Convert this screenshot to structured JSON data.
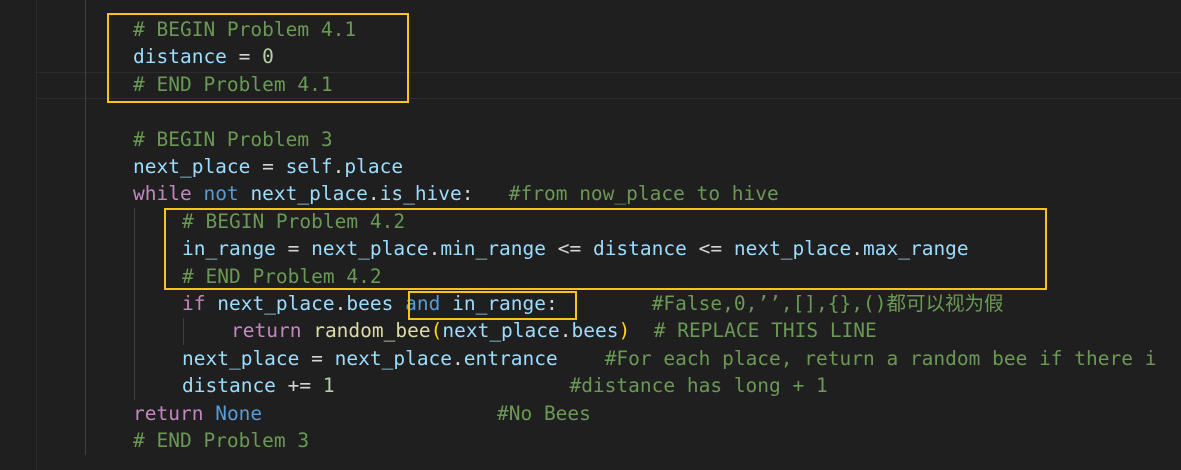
{
  "editor": {
    "lines": [
      {
        "indent": 2,
        "tokens": [
          {
            "t": "# BEGIN Problem 4.1",
            "c": "comment"
          }
        ]
      },
      {
        "indent": 2,
        "tokens": [
          {
            "t": "distance",
            "c": "ident"
          },
          {
            "t": " = ",
            "c": "op"
          },
          {
            "t": "0",
            "c": "num"
          }
        ]
      },
      {
        "indent": 2,
        "tokens": [
          {
            "t": "# END Problem 4.1",
            "c": "comment"
          }
        ]
      },
      {
        "indent": 0,
        "tokens": []
      },
      {
        "indent": 2,
        "tokens": [
          {
            "t": "# BEGIN Problem 3",
            "c": "comment"
          }
        ]
      },
      {
        "indent": 2,
        "tokens": [
          {
            "t": "next_place",
            "c": "ident"
          },
          {
            "t": " = ",
            "c": "op"
          },
          {
            "t": "self",
            "c": "ident"
          },
          {
            "t": ".",
            "c": "op"
          },
          {
            "t": "place",
            "c": "ident"
          }
        ]
      },
      {
        "indent": 2,
        "tokens": [
          {
            "t": "while",
            "c": "kw"
          },
          {
            "t": " ",
            "c": "op"
          },
          {
            "t": "not",
            "c": "kw2"
          },
          {
            "t": " ",
            "c": "op"
          },
          {
            "t": "next_place",
            "c": "ident"
          },
          {
            "t": ".",
            "c": "op"
          },
          {
            "t": "is_hive",
            "c": "ident"
          },
          {
            "t": ":   ",
            "c": "op"
          },
          {
            "t": "#from now_place to hive",
            "c": "comment"
          }
        ]
      },
      {
        "indent": 3,
        "tokens": [
          {
            "t": "# BEGIN Problem 4.2",
            "c": "comment"
          }
        ]
      },
      {
        "indent": 3,
        "tokens": [
          {
            "t": "in_range",
            "c": "ident"
          },
          {
            "t": " = ",
            "c": "op"
          },
          {
            "t": "next_place",
            "c": "ident"
          },
          {
            "t": ".",
            "c": "op"
          },
          {
            "t": "min_range",
            "c": "ident"
          },
          {
            "t": " <= ",
            "c": "op"
          },
          {
            "t": "distance",
            "c": "ident"
          },
          {
            "t": " <= ",
            "c": "op"
          },
          {
            "t": "next_place",
            "c": "ident"
          },
          {
            "t": ".",
            "c": "op"
          },
          {
            "t": "max_range",
            "c": "ident"
          }
        ]
      },
      {
        "indent": 3,
        "tokens": [
          {
            "t": "# END Problem 4.2",
            "c": "comment"
          }
        ]
      },
      {
        "indent": 3,
        "tokens": [
          {
            "t": "if",
            "c": "kw"
          },
          {
            "t": " ",
            "c": "op"
          },
          {
            "t": "next_place",
            "c": "ident"
          },
          {
            "t": ".",
            "c": "op"
          },
          {
            "t": "bees",
            "c": "ident"
          },
          {
            "t": " ",
            "c": "op"
          },
          {
            "t": "and",
            "c": "kw2"
          },
          {
            "t": " ",
            "c": "op"
          },
          {
            "t": "in_range",
            "c": "ident"
          },
          {
            "t": ":        ",
            "c": "op"
          },
          {
            "t": "#False,0,’’,[],{},()都可以视为假",
            "c": "comment"
          }
        ]
      },
      {
        "indent": 4,
        "tokens": [
          {
            "t": "return",
            "c": "kw"
          },
          {
            "t": " ",
            "c": "op"
          },
          {
            "t": "random_bee",
            "c": "func"
          },
          {
            "t": "(",
            "c": "paren"
          },
          {
            "t": "next_place",
            "c": "ident"
          },
          {
            "t": ".",
            "c": "op"
          },
          {
            "t": "bees",
            "c": "ident"
          },
          {
            "t": ")",
            "c": "paren"
          },
          {
            "t": "  ",
            "c": "op"
          },
          {
            "t": "# REPLACE THIS LINE",
            "c": "comment"
          }
        ]
      },
      {
        "indent": 3,
        "tokens": [
          {
            "t": "next_place",
            "c": "ident"
          },
          {
            "t": " = ",
            "c": "op"
          },
          {
            "t": "next_place",
            "c": "ident"
          },
          {
            "t": ".",
            "c": "op"
          },
          {
            "t": "entrance",
            "c": "ident"
          },
          {
            "t": "    ",
            "c": "op"
          },
          {
            "t": "#For each place, return a random bee if there i",
            "c": "comment"
          }
        ]
      },
      {
        "indent": 3,
        "tokens": [
          {
            "t": "distance",
            "c": "ident"
          },
          {
            "t": " += ",
            "c": "op"
          },
          {
            "t": "1",
            "c": "num"
          },
          {
            "t": "                    ",
            "c": "op"
          },
          {
            "t": "#distance has long + 1",
            "c": "comment"
          }
        ]
      },
      {
        "indent": 2,
        "tokens": [
          {
            "t": "return",
            "c": "kw"
          },
          {
            "t": " ",
            "c": "op"
          },
          {
            "t": "None",
            "c": "kw2"
          },
          {
            "t": "                    ",
            "c": "op"
          },
          {
            "t": "#No Bees",
            "c": "comment"
          }
        ]
      },
      {
        "indent": 2,
        "tokens": [
          {
            "t": "# END Problem 3",
            "c": "comment"
          }
        ]
      }
    ]
  }
}
